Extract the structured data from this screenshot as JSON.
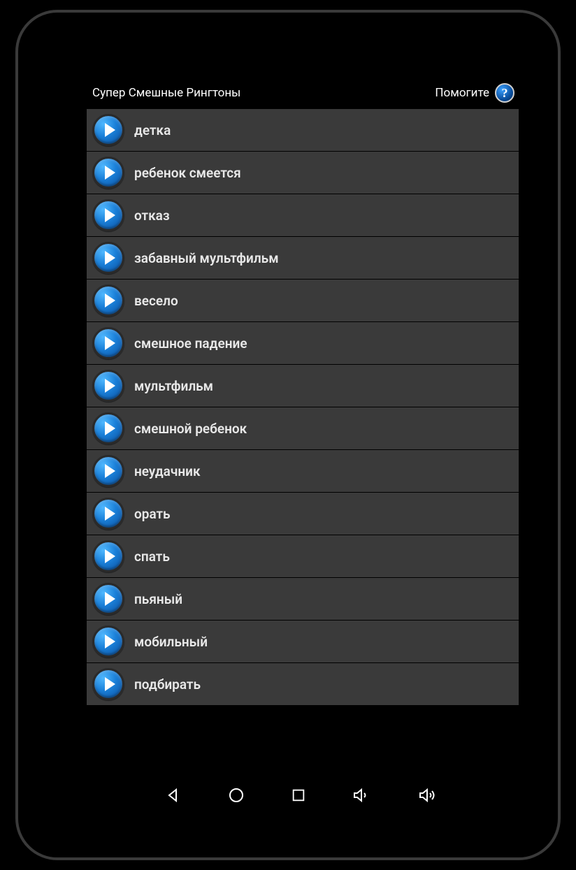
{
  "header": {
    "title": "Супер Смешные Рингтоны",
    "help_label": "Помогите",
    "help_symbol": "?"
  },
  "ringtones": [
    {
      "label": "детка"
    },
    {
      "label": "ребенок смеется"
    },
    {
      "label": "отказ"
    },
    {
      "label": "забавный мультфильм"
    },
    {
      "label": "весело"
    },
    {
      "label": "смешное падение"
    },
    {
      "label": "мультфильм"
    },
    {
      "label": "смешной ребенок"
    },
    {
      "label": "неудачник"
    },
    {
      "label": "орать"
    },
    {
      "label": "спать"
    },
    {
      "label": "пьяный"
    },
    {
      "label": "мобильный"
    },
    {
      "label": "подбирать"
    }
  ]
}
